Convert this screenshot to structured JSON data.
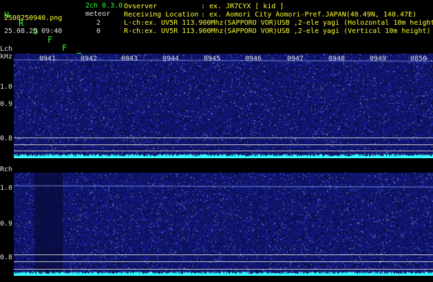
{
  "header": {
    "brand_letters": [
      "H",
      "R",
      "O",
      "F",
      "F",
      "T"
    ],
    "channel_mode": "2ch 0.3.0",
    "meteor_label": "meteor",
    "filename": "2508250940.png",
    "datetime": "25.08.25 09:40",
    "meteor_count_l": "2",
    "meteor_count_r": "0",
    "observer_label": "Ovserver",
    "observer_value": ": ex. JR7CYX [ kid ]",
    "location_label": "Receiving Location",
    "location_value": ": ex. Aomori City Aomori-Pref.JAPAN(40.49N, 140.47E)",
    "lch_desc": "L-ch:ex. UV5R 113.900Mhz(SAPPORO VOR)USB ,2-ele yagi (Holozontal 10m height)",
    "rch_desc": "R-ch:ex. UV5R 113.900Mhz(SAPPORO VOR)USB ,2-ele yagi (Vertical 10m height)"
  },
  "lch": {
    "label": "Lch",
    "unit": "kHz",
    "y_ticks": [
      "1.0",
      "0.9",
      "0.8"
    ],
    "time_labels": [
      "0941",
      "0942",
      "0943",
      "0944",
      "0945",
      "0946",
      "0947",
      "0948",
      "0949",
      "0850"
    ]
  },
  "rch": {
    "label": "Rch",
    "y_ticks": [
      "1.0",
      "0.9",
      "0.8"
    ]
  },
  "colors": {
    "text_green": "#33ff33",
    "text_yellow": "#ffff33",
    "text_white": "#e0e0e0",
    "signal_cyan": "#33ffff",
    "noise_blue": "#1a2aa0"
  }
}
